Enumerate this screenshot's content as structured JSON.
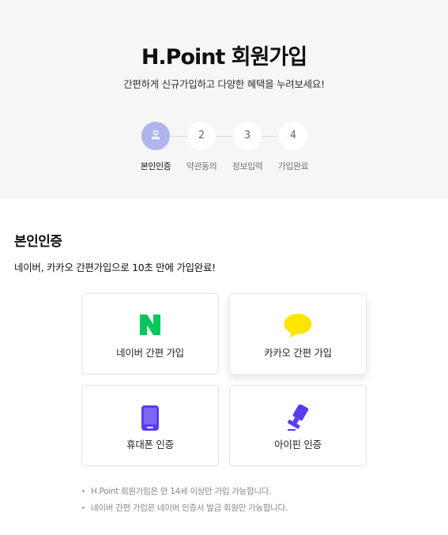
{
  "header": {
    "title": "H.Point 회원가입",
    "subtitle": "간편하게 신규가입하고 다양한 혜택을 누려보세요!"
  },
  "steps": [
    {
      "label": "본인인증",
      "number": "",
      "icon": "person-icon",
      "active": true
    },
    {
      "label": "약관동의",
      "number": "2",
      "active": false
    },
    {
      "label": "정보입력",
      "number": "3",
      "active": false
    },
    {
      "label": "가입완료",
      "number": "4",
      "active": false
    }
  ],
  "section": {
    "title": "본인인증",
    "desc": "네이버, 카카오 간편가입으로 10초 만에 가입완료!"
  },
  "options": {
    "naver": {
      "label": "네이버 간편 가입",
      "icon": "naver-logo-icon",
      "color": "#03c75a"
    },
    "kakao": {
      "label": "카카오 간편 가입",
      "icon": "kakao-speech-bubble-icon",
      "color": "#fee500"
    },
    "phone": {
      "label": "휴대폰 인증",
      "icon": "mobile-phone-icon",
      "color": "#5a3cf0"
    },
    "ipin": {
      "label": "아이핀 인증",
      "icon": "stamp-icon",
      "color": "#5a3cf0"
    }
  },
  "notes": [
    "H.Point 회원가입은 만 14세 이상만 가입 가능합니다.",
    "네이버 간편 가입은 네이버 인증서 발급 회원만 가능합니다."
  ],
  "colors": {
    "accent": "#aeb4ee",
    "hero_bg": "#f6f6f6"
  }
}
